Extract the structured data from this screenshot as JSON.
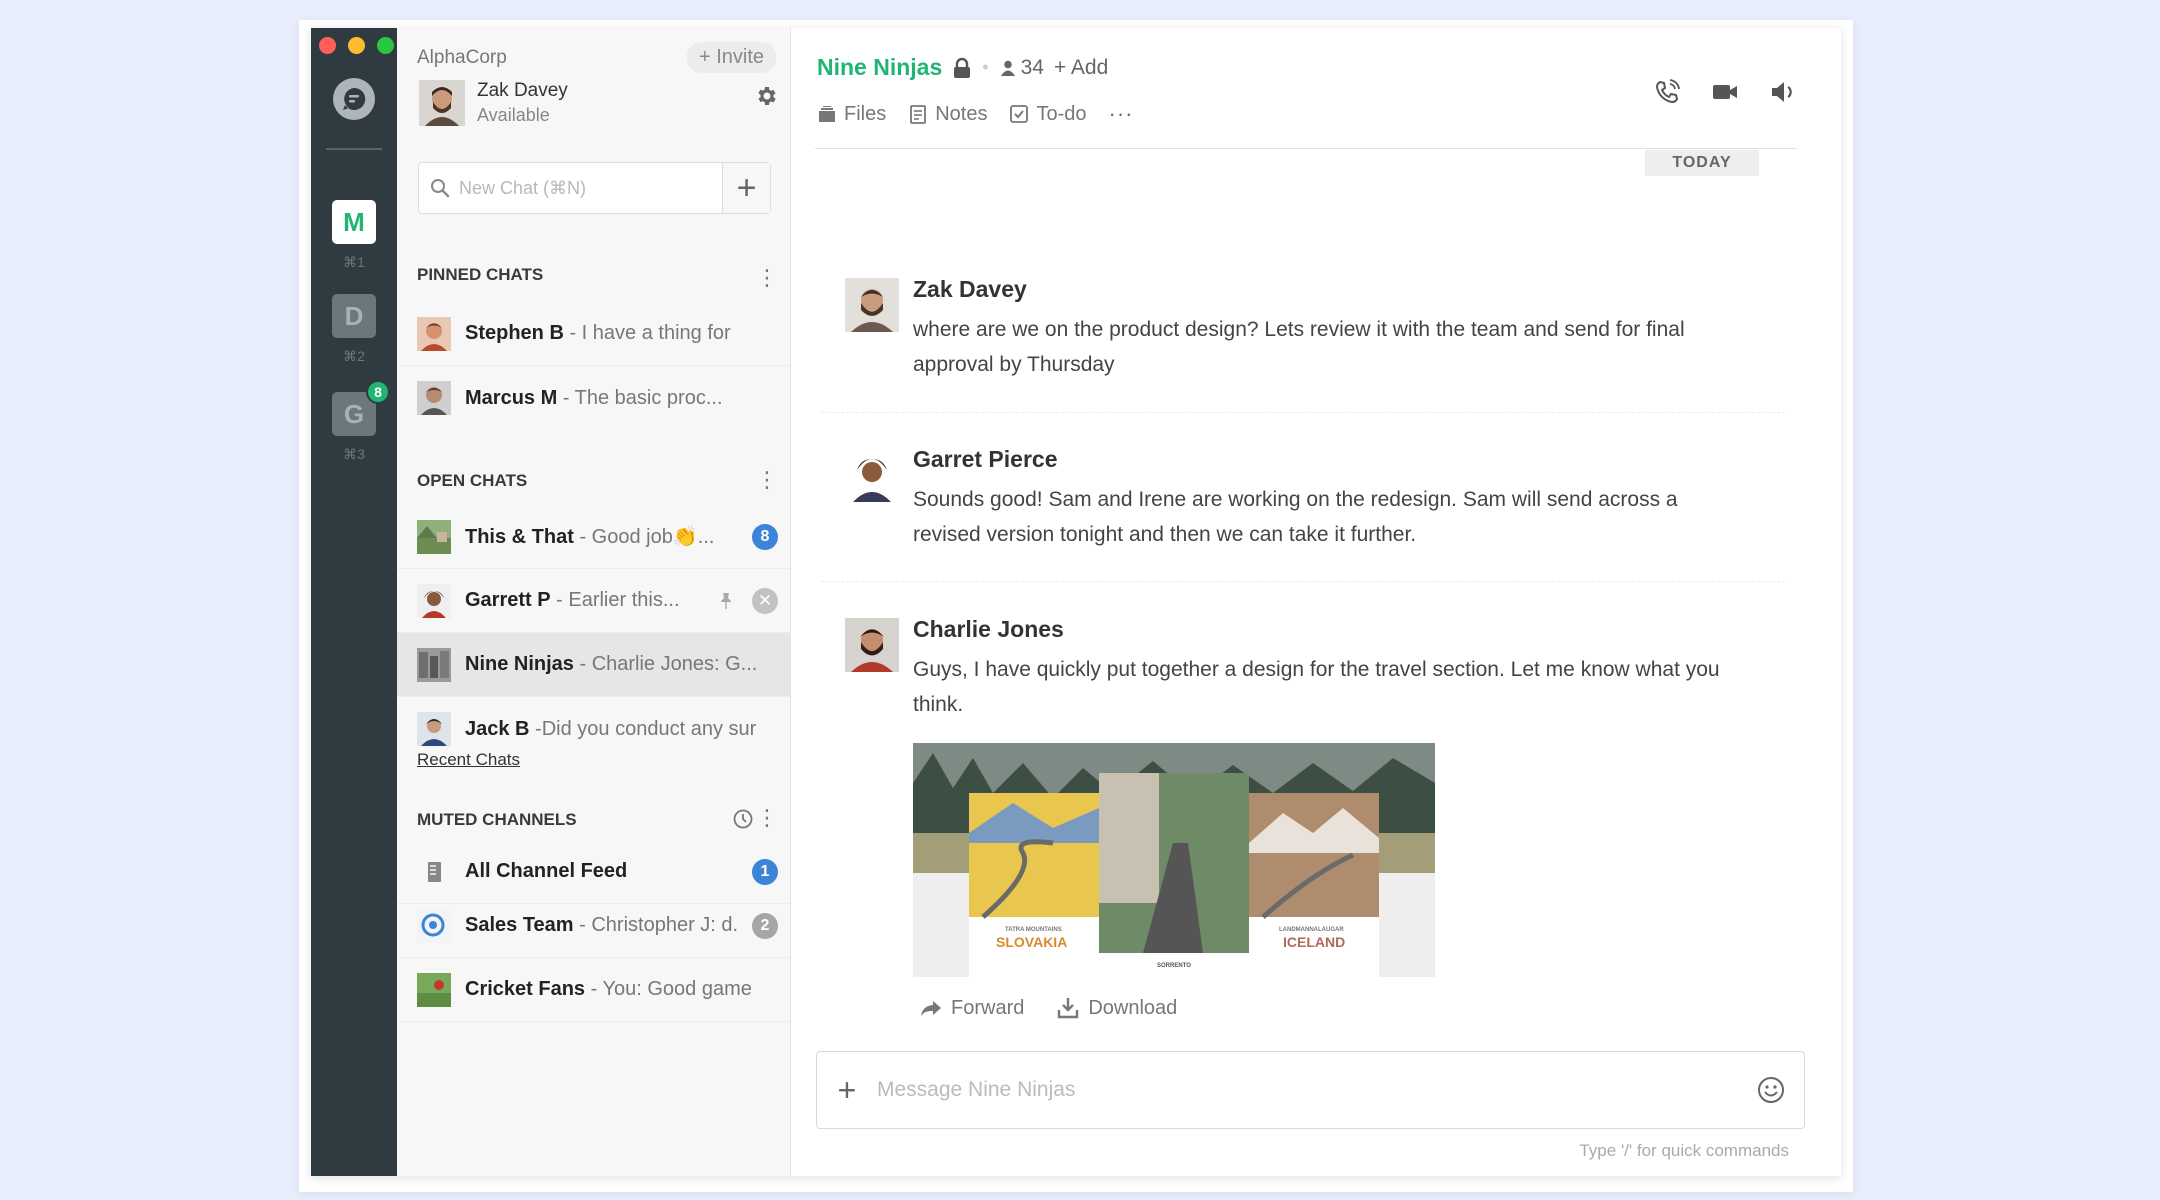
{
  "colors": {
    "brand_green": "#21b573",
    "badge_blue": "#3b84d8",
    "rail_bg": "#2f3b41"
  },
  "rail": {
    "workspaces": [
      {
        "letter": "M",
        "shortcut": "⌘1",
        "active": true
      },
      {
        "letter": "D",
        "shortcut": "⌘2",
        "active": false
      },
      {
        "letter": "G",
        "shortcut": "⌘3",
        "active": false,
        "badge": "8"
      }
    ]
  },
  "sidebar": {
    "org_name": "AlphaCorp",
    "invite_label": "+ Invite",
    "user": {
      "name": "Zak Davey",
      "status": "Available"
    },
    "search_placeholder": "New Chat (⌘N)",
    "pinned": {
      "title": "PINNED CHATS",
      "items": [
        {
          "name": "Stephen B",
          "preview": " - I have a thing for"
        },
        {
          "name": "Marcus M",
          "preview": " - The basic proc..."
        }
      ]
    },
    "open": {
      "title": "OPEN CHATS",
      "items": [
        {
          "name": "This & That",
          "preview": " - Good job👏...",
          "badge": "8"
        },
        {
          "name": "Garrett P",
          "preview": " - Earlier this..."
        },
        {
          "name": "Nine Ninjas",
          "preview": " - Charlie Jones: G..."
        },
        {
          "name": "Jack B",
          "preview": " -Did you conduct any sur"
        }
      ],
      "recent_link": "Recent Chats"
    },
    "muted": {
      "title": "MUTED CHANNELS",
      "items": [
        {
          "name": "All Channel Feed",
          "preview": "",
          "badge": "1"
        },
        {
          "name": "Sales Team",
          "preview": " - Christopher J: d.",
          "badge": "2"
        },
        {
          "name": "Cricket Fans",
          "preview": " - You: Good game"
        }
      ]
    }
  },
  "channel": {
    "name": "Nine Ninjas",
    "member_count": "34",
    "add_label": "+ Add",
    "tabs": [
      {
        "label": "Files",
        "icon": "files-icon"
      },
      {
        "label": "Notes",
        "icon": "notes-icon"
      },
      {
        "label": "To-do",
        "icon": "todo-icon"
      }
    ],
    "more_label": "···",
    "date_divider": "TODAY"
  },
  "messages": [
    {
      "author": "Zak Davey",
      "text": "where are we on the product design? Lets review it with the team and send for final approval by Thursday"
    },
    {
      "author": "Garret Pierce",
      "text": "Sounds good! Sam and Irene are working on the redesign. Sam will send across a revised version tonight and then we can take it further."
    },
    {
      "author": "Charlie Jones",
      "text": "Guys, I have quickly put together a design for the travel section. Let me know what you think.",
      "attachment": {
        "card_left_title": "SLOVAKIA",
        "card_left_sub": "TATRA MOUNTAINS",
        "card_mid_title": "SORRENTO",
        "card_right_title": "ICELAND",
        "card_right_sub": "LANDMANNALAUGAR"
      },
      "actions": {
        "forward": "Forward",
        "download": "Download"
      }
    }
  ],
  "composer": {
    "placeholder": "Message Nine Ninjas",
    "hint": "Type '/' for quick commands"
  }
}
